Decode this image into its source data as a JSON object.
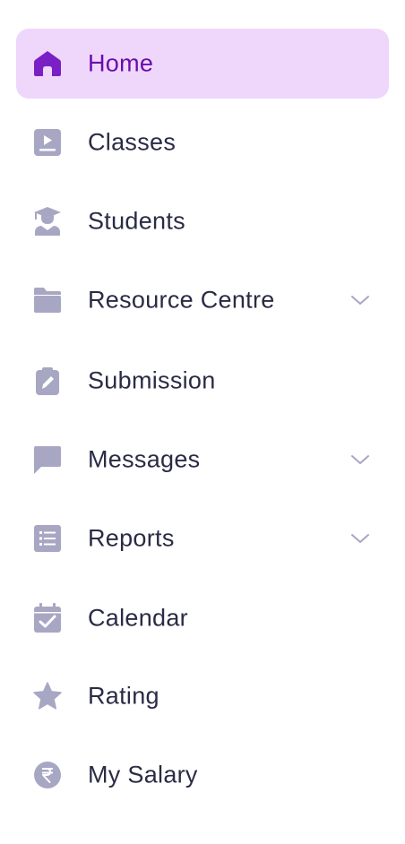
{
  "colors": {
    "active_background": "#efd6fb",
    "active_accent": "#6a0dad",
    "icon_gray": "#a7a7c4",
    "text": "#2a2b45"
  },
  "nav": {
    "items": [
      {
        "label": "Home",
        "icon": "home-icon",
        "active": true,
        "expandable": false
      },
      {
        "label": "Classes",
        "icon": "video-lesson-icon",
        "active": false,
        "expandable": false
      },
      {
        "label": "Students",
        "icon": "graduate-student-icon",
        "active": false,
        "expandable": false
      },
      {
        "label": "Resource Centre",
        "icon": "folder-icon",
        "active": false,
        "expandable": true
      },
      {
        "label": "Submission",
        "icon": "clipboard-edit-icon",
        "active": false,
        "expandable": false
      },
      {
        "label": "Messages",
        "icon": "chat-bubble-icon",
        "active": false,
        "expandable": true
      },
      {
        "label": "Reports",
        "icon": "list-report-icon",
        "active": false,
        "expandable": true
      },
      {
        "label": "Calendar",
        "icon": "calendar-check-icon",
        "active": false,
        "expandable": false
      },
      {
        "label": "Rating",
        "icon": "star-icon",
        "active": false,
        "expandable": false
      },
      {
        "label": "My Salary",
        "icon": "rupee-coin-icon",
        "active": false,
        "expandable": false
      }
    ]
  }
}
